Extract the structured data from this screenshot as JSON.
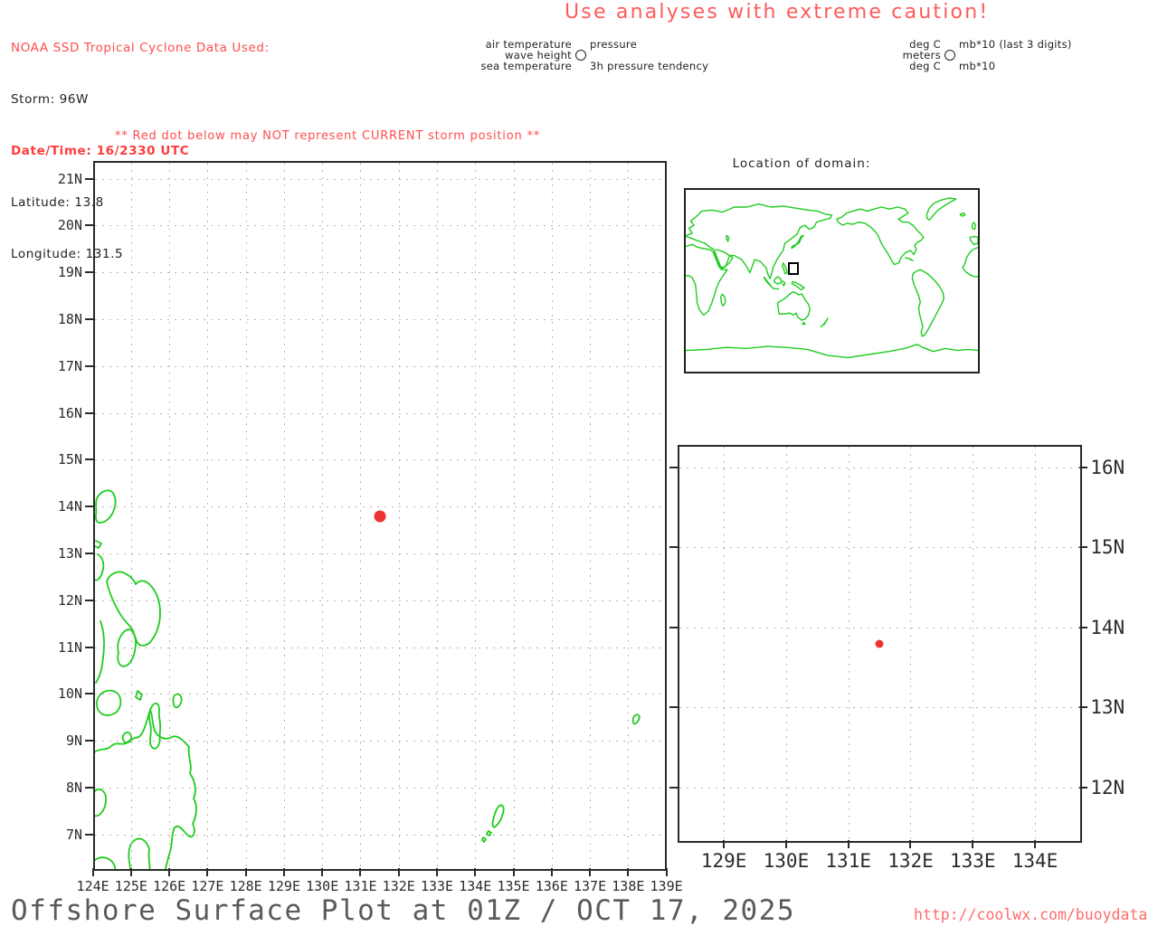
{
  "info_panel": {
    "source_line": "NOAA SSD Tropical Cyclone Data Used:",
    "storm_line": "Storm: 96W",
    "datetime_line": "Date/Time: 16/2330 UTC",
    "latitude_line": "Latitude: 13.8",
    "longitude_line": "Longitude: 131.5"
  },
  "caution_banner": "Use analyses with extreme caution!",
  "station_legend": {
    "labels": {
      "air_temperature": "air temperature",
      "wave_height": "wave height",
      "sea_temperature": "sea temperature",
      "pressure": "pressure",
      "pressure_tendency": "3h pressure tendency"
    },
    "units": {
      "air_temperature_units": "deg C",
      "wave_height_units": "meters",
      "sea_temperature_units": "deg C",
      "pressure_units": "mb*10 (last 3 digits)",
      "pressure_tendency_units": "mb*10"
    }
  },
  "warning_note": "** Red dot below may NOT represent CURRENT storm position **",
  "main_map": {
    "lat_labels": [
      "21N",
      "20N",
      "19N",
      "18N",
      "17N",
      "16N",
      "15N",
      "14N",
      "13N",
      "12N",
      "11N",
      "10N",
      "9N",
      "8N",
      "7N"
    ],
    "lon_labels": [
      "124E",
      "125E",
      "126E",
      "127E",
      "128E",
      "129E",
      "130E",
      "131E",
      "132E",
      "133E",
      "134E",
      "135E",
      "136E",
      "137E",
      "138E",
      "139E"
    ]
  },
  "domain_inset": {
    "title": "Location of domain:"
  },
  "zoom_inset": {
    "lat_labels": [
      "16N",
      "15N",
      "14N",
      "13N",
      "12N"
    ],
    "lon_labels": [
      "129E",
      "130E",
      "131E",
      "132E",
      "133E",
      "134E"
    ]
  },
  "storm": {
    "id": "96W",
    "lat": 13.8,
    "lon": 131.5
  },
  "footer": {
    "title": "Offshore Surface Plot at 01Z / OCT 17, 2025",
    "url": "http://coolwx.com/buoydata"
  },
  "colors": {
    "alert_red": "#ff4d4d",
    "storm_dot_red": "#ee3333",
    "coastline_green": "#1ecc1e"
  }
}
